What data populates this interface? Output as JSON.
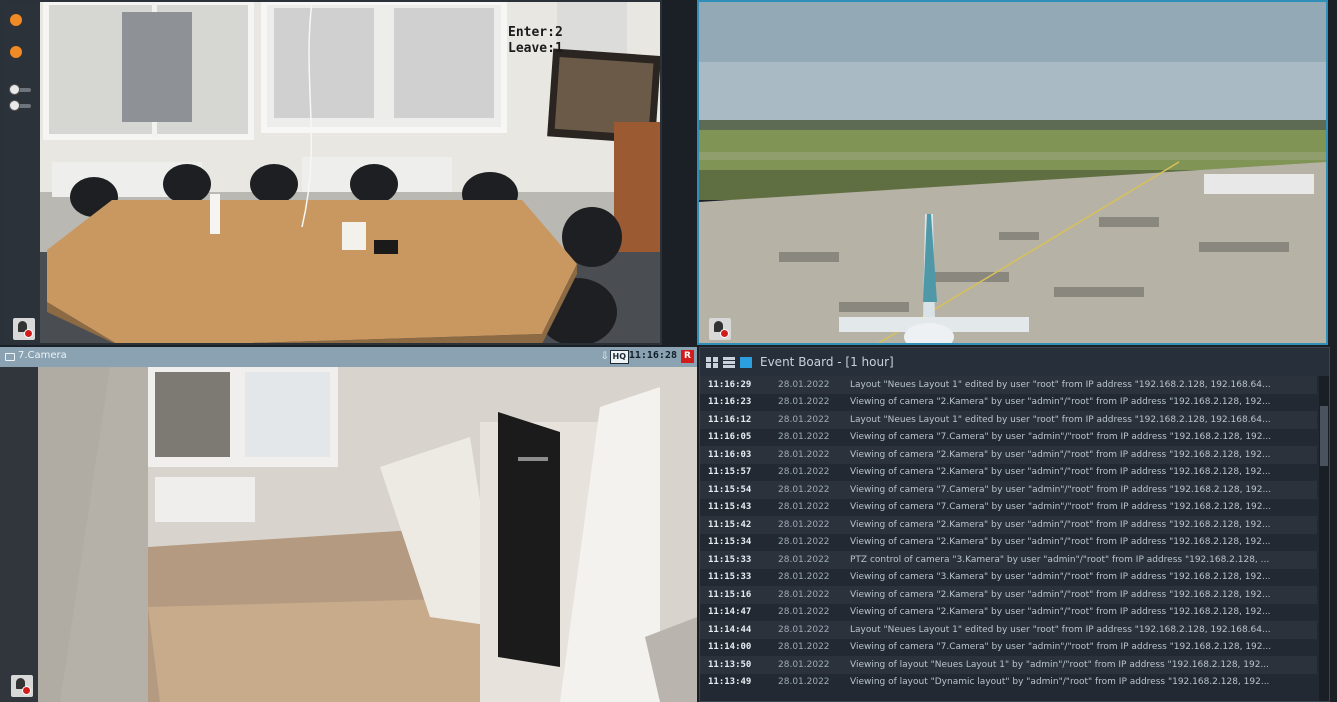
{
  "camera_top_left": {
    "counter_enter": "Enter:2",
    "counter_leave": "Leave:1"
  },
  "camera_bottom_left": {
    "title": "7.Camera",
    "quality": "HQ",
    "time": "11:16:28",
    "record_label": "R"
  },
  "event_board": {
    "title": "Event Board - [1 hour]",
    "events": [
      {
        "time": "11:16:29",
        "date": "28.01.2022",
        "message": "Layout \"Neues Layout 1\" edited by user \"root\" from IP address \"192.168.2.128, 192.168.64..."
      },
      {
        "time": "11:16:23",
        "date": "28.01.2022",
        "message": "Viewing of camera \"2.Kamera\" by user \"admin\"/\"root\" from IP address \"192.168.2.128, 192..."
      },
      {
        "time": "11:16:12",
        "date": "28.01.2022",
        "message": "Layout \"Neues Layout 1\" edited by user \"root\" from IP address \"192.168.2.128, 192.168.64..."
      },
      {
        "time": "11:16:05",
        "date": "28.01.2022",
        "message": "Viewing of camera \"7.Camera\" by user \"admin\"/\"root\" from IP address \"192.168.2.128, 192..."
      },
      {
        "time": "11:16:03",
        "date": "28.01.2022",
        "message": "Viewing of camera \"2.Kamera\" by user \"admin\"/\"root\" from IP address \"192.168.2.128, 192..."
      },
      {
        "time": "11:15:57",
        "date": "28.01.2022",
        "message": "Viewing of camera \"2.Kamera\" by user \"admin\"/\"root\" from IP address \"192.168.2.128, 192..."
      },
      {
        "time": "11:15:54",
        "date": "28.01.2022",
        "message": "Viewing of camera \"7.Camera\" by user \"admin\"/\"root\" from IP address \"192.168.2.128, 192..."
      },
      {
        "time": "11:15:43",
        "date": "28.01.2022",
        "message": "Viewing of camera \"7.Camera\" by user \"admin\"/\"root\" from IP address \"192.168.2.128, 192..."
      },
      {
        "time": "11:15:42",
        "date": "28.01.2022",
        "message": "Viewing of camera \"2.Kamera\" by user \"admin\"/\"root\" from IP address \"192.168.2.128, 192..."
      },
      {
        "time": "11:15:34",
        "date": "28.01.2022",
        "message": "Viewing of camera \"2.Kamera\" by user \"admin\"/\"root\" from IP address \"192.168.2.128, 192..."
      },
      {
        "time": "11:15:33",
        "date": "28.01.2022",
        "message": "PTZ control of camera \"3.Kamera\" by user \"admin\"/\"root\" from IP address \"192.168.2.128, ..."
      },
      {
        "time": "11:15:33",
        "date": "28.01.2022",
        "message": "Viewing of camera \"3.Kamera\" by user \"admin\"/\"root\" from IP address \"192.168.2.128, 192..."
      },
      {
        "time": "11:15:16",
        "date": "28.01.2022",
        "message": "Viewing of camera \"2.Kamera\" by user \"admin\"/\"root\" from IP address \"192.168.2.128, 192..."
      },
      {
        "time": "11:14:47",
        "date": "28.01.2022",
        "message": "Viewing of camera \"2.Kamera\" by user \"admin\"/\"root\" from IP address \"192.168.2.128, 192..."
      },
      {
        "time": "11:14:44",
        "date": "28.01.2022",
        "message": "Layout \"Neues Layout 1\" edited by user \"root\" from IP address \"192.168.2.128, 192.168.64..."
      },
      {
        "time": "11:14:00",
        "date": "28.01.2022",
        "message": "Viewing of camera \"7.Camera\" by user \"admin\"/\"root\" from IP address \"192.168.2.128, 192..."
      },
      {
        "time": "11:13:50",
        "date": "28.01.2022",
        "message": "Viewing of layout \"Neues Layout 1\" by \"admin\"/\"root\" from IP address \"192.168.2.128, 192..."
      },
      {
        "time": "11:13:49",
        "date": "28.01.2022",
        "message": "Viewing of layout \"Dynamic layout\" by \"admin\"/\"root\" from IP address \"192.168.2.128, 192..."
      }
    ]
  },
  "colors": {
    "accent_border": "#2f8fb8",
    "record_red": "#d31b1b",
    "indicator_orange": "#f08a24",
    "header_bg": "#8aa2b2"
  },
  "icons": [
    "circle-indicator-icon",
    "toggle-icon",
    "bell-alarm-icon",
    "camera-icon",
    "download-arrow-icon",
    "grid-layout-icon",
    "list-layout-icon",
    "blue-square-icon"
  ]
}
